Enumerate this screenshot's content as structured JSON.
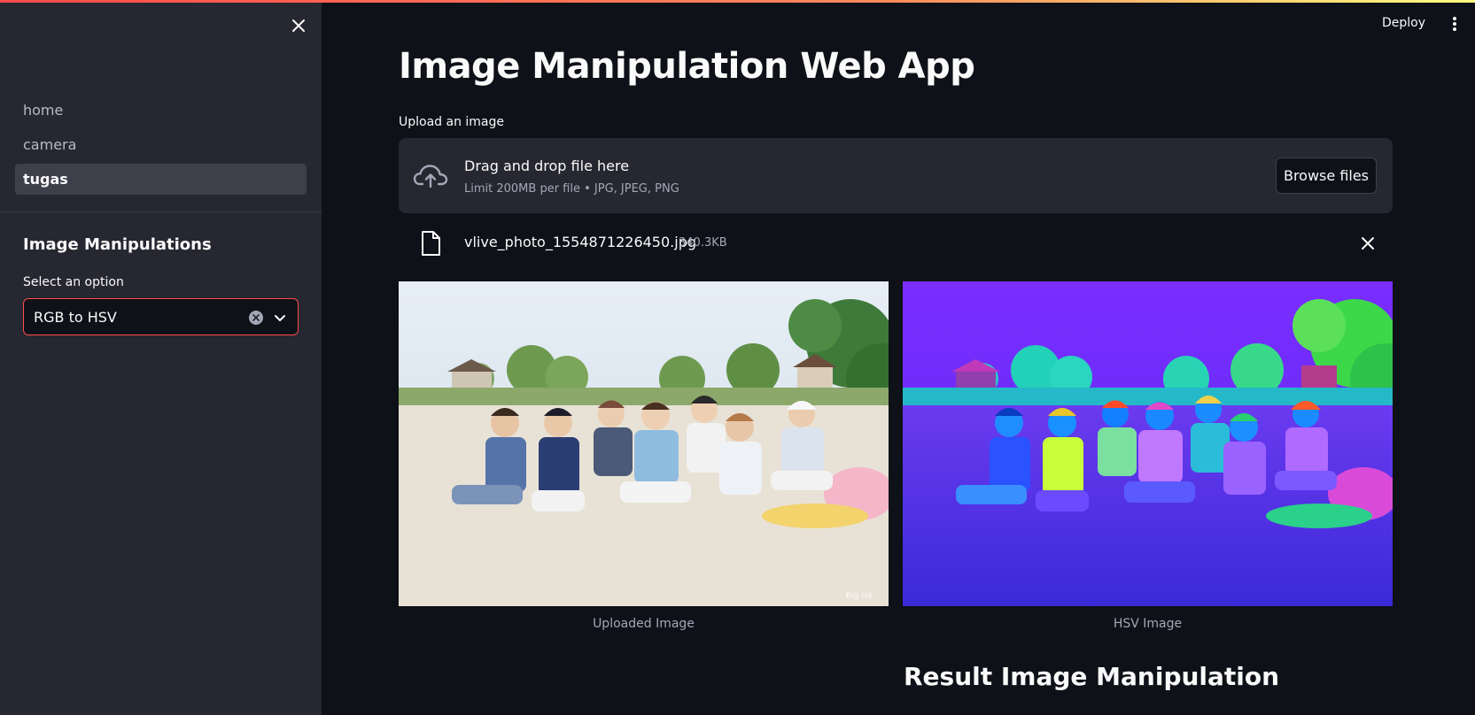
{
  "sidebar": {
    "nav": [
      {
        "label": "home",
        "active": false
      },
      {
        "label": "camera",
        "active": false
      },
      {
        "label": "tugas",
        "active": true
      }
    ],
    "section_title": "Image Manipulations",
    "select_label": "Select an option",
    "select_value": "RGB to HSV"
  },
  "header": {
    "deploy_label": "Deploy"
  },
  "main": {
    "title": "Image Manipulation Web App",
    "upload_label": "Upload an image",
    "dropzone": {
      "title": "Drag and drop file here",
      "subtitle": "Limit 200MB per file • JPG, JPEG, PNG",
      "browse_label": "Browse files"
    },
    "file": {
      "name": "vlive_photo_1554871226450.jpg",
      "size": "340.3KB"
    },
    "images": [
      {
        "caption": "Uploaded Image",
        "watermark": "Big Hit"
      },
      {
        "caption": "HSV Image"
      }
    ],
    "result_heading": "Result Image Manipulation"
  },
  "colors": {
    "background": "#0e1117",
    "sidebar": "#262730",
    "accent": "#ff4b4b"
  }
}
